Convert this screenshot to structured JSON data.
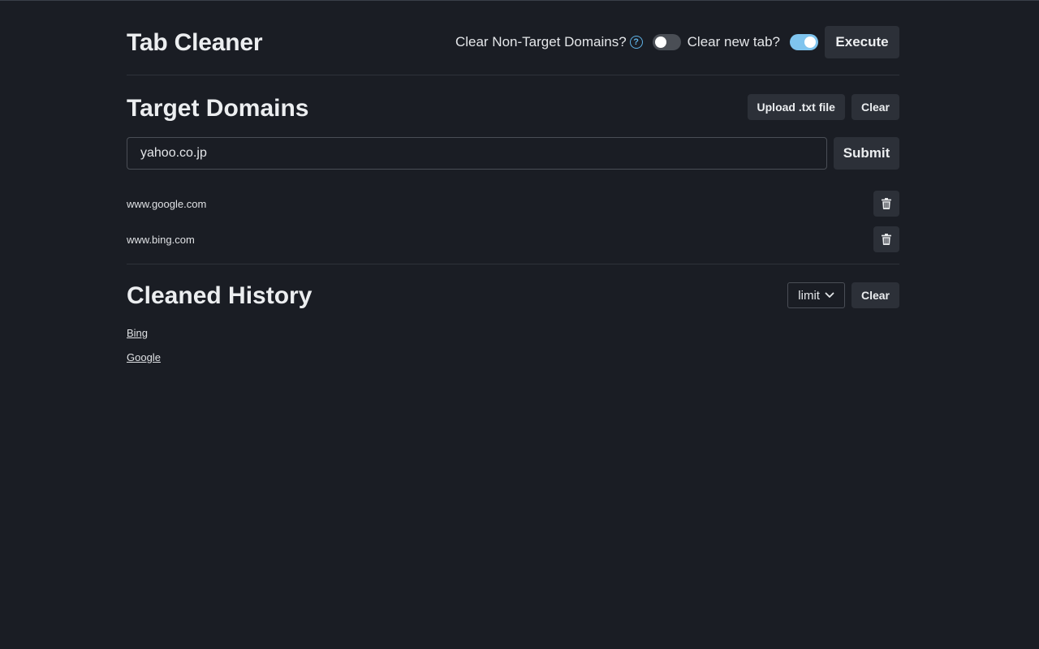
{
  "app": {
    "title": "Tab Cleaner"
  },
  "header": {
    "clear_non_target_label": "Clear Non-Target Domains?",
    "clear_non_target_enabled": false,
    "clear_new_tab_label": "Clear new tab?",
    "clear_new_tab_enabled": true,
    "execute_label": "Execute",
    "help_glyph": "?"
  },
  "target_domains": {
    "title": "Target Domains",
    "upload_label": "Upload .txt file",
    "clear_label": "Clear",
    "input_value": "yahoo.co.jp",
    "submit_label": "Submit",
    "items": [
      {
        "domain": "www.google.com"
      },
      {
        "domain": "www.bing.com"
      }
    ]
  },
  "cleaned_history": {
    "title": "Cleaned History",
    "limit_label": "limit",
    "clear_label": "Clear",
    "items": [
      {
        "label": "Bing"
      },
      {
        "label": "Google"
      }
    ]
  },
  "colors": {
    "background": "#1a1d24",
    "button_bg": "#2c3038",
    "toggle_on": "#7fc4ee",
    "toggle_off": "#4a4e55",
    "help_icon": "#5fb2e6"
  }
}
